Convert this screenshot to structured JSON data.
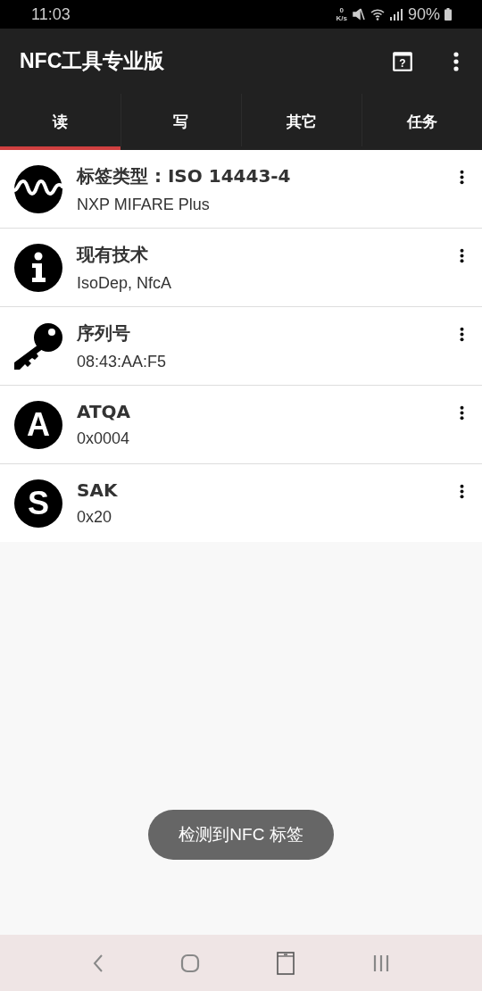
{
  "status_bar": {
    "time": "11:03",
    "net_speed_value": "0",
    "net_speed_unit": "K/s",
    "battery": "90%"
  },
  "app_bar": {
    "title": "NFC工具专业版",
    "help_glyph": "?"
  },
  "tabs": [
    {
      "label": "读",
      "selected": true
    },
    {
      "label": "写",
      "selected": false
    },
    {
      "label": "其它",
      "selected": false
    },
    {
      "label": "任务",
      "selected": false
    }
  ],
  "records": [
    {
      "kind": "wave",
      "title": "标签类型 : ISO 14443-4",
      "value": "NXP MIFARE Plus"
    },
    {
      "kind": "info",
      "title": "现有技术",
      "value": "IsoDep, NfcA"
    },
    {
      "kind": "key",
      "title": "序列号",
      "value": "08:43:AA:F5"
    },
    {
      "kind": "letter",
      "letter": "A",
      "title": "ATQA",
      "value": "0x0004"
    },
    {
      "kind": "letter",
      "letter": "S",
      "title": "SAK",
      "value": "0x20"
    }
  ],
  "toast": "检测到NFC 标签"
}
